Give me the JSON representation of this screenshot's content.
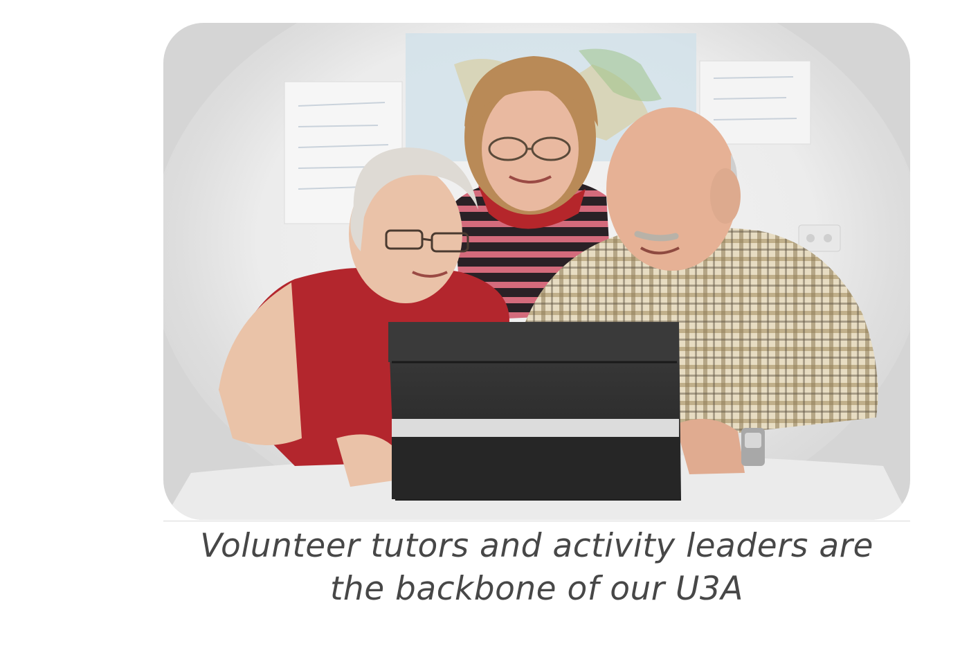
{
  "caption": {
    "line1": "Volunteer tutors and activity leaders are",
    "line2": "the backbone of our U3A"
  },
  "colors": {
    "frame": "#d5d5d5",
    "caption_text": "#474747",
    "divider": "#d8d8d8",
    "red_top": "#b5262b",
    "laptop": "#2e2e2e"
  },
  "photo": {
    "subject": "three older adults looking at a laptop"
  }
}
